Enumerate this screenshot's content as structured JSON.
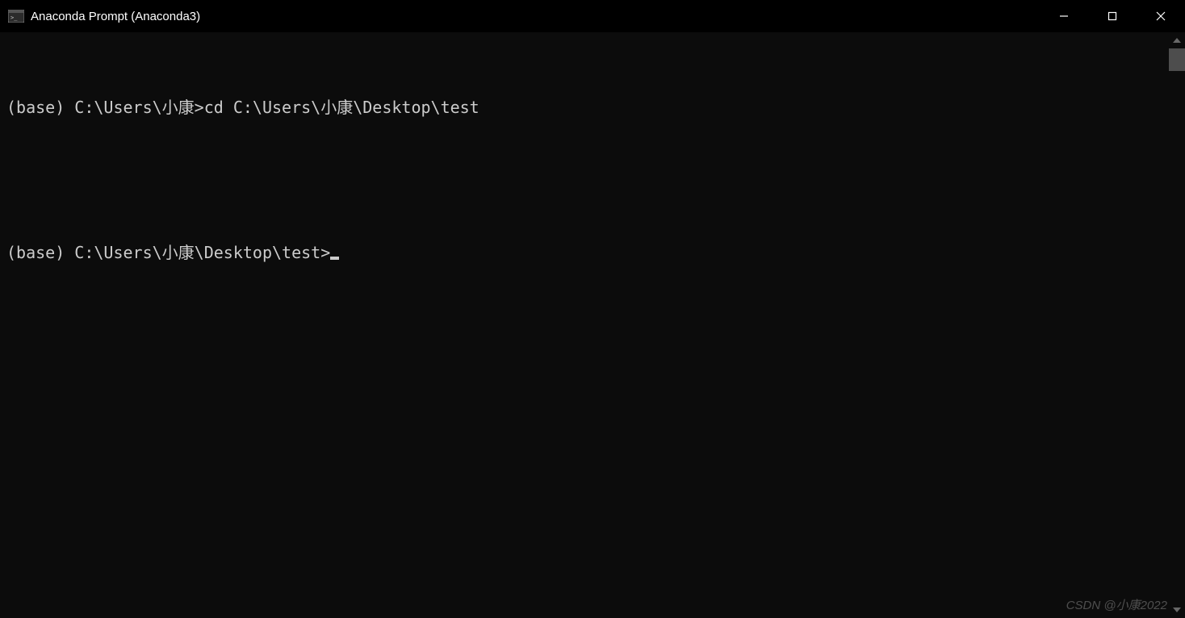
{
  "window": {
    "title": "Anaconda Prompt (Anaconda3)"
  },
  "terminal": {
    "lines": [
      {
        "prompt": "(base) C:\\Users\\小康>",
        "command": "cd C:\\Users\\小康\\Desktop\\test"
      },
      {
        "prompt": "(base) C:\\Users\\小康\\Desktop\\test>",
        "command": ""
      }
    ]
  },
  "watermark": "CSDN @小康2022"
}
